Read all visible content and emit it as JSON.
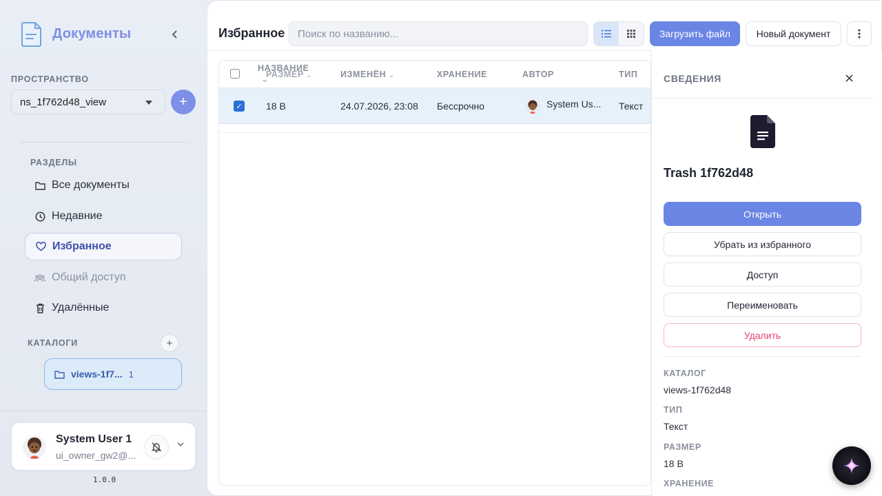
{
  "sidebar": {
    "brand_title": "Документы",
    "space_caption": "ПРОСТРАНСТВО",
    "namespace_value": "ns_1f762d48_view",
    "sections_caption": "РАЗДЕЛЫ",
    "nav": {
      "all": "Все документы",
      "recent": "Недавние",
      "favorites": "Избранное",
      "shared": "Общий доступ",
      "deleted": "Удалённые"
    },
    "catalogs_caption": "КАТАЛОГИ",
    "catalog": {
      "name": "views-1f7...",
      "count": "1"
    },
    "user": {
      "name": "System User 1",
      "email": "ui_owner_gw2@..."
    },
    "version": "1.0.0"
  },
  "header": {
    "title": "Избранное",
    "search_placeholder": "Поиск по названию...",
    "upload_label": "Загрузить файл",
    "new_doc_label": "Новый документ"
  },
  "table": {
    "columns": {
      "name": "НАЗВАНИЕ",
      "size": "РАЗМЕР",
      "modified": "ИЗМЕНЁН",
      "storage": "ХРАНЕНИЕ",
      "author": "АВТОР",
      "type": "ТИП"
    },
    "row": {
      "size": "18 B",
      "modified": "24.07.2026, 23:08",
      "storage": "Бессрочно",
      "author": "System Us...",
      "type": "Текст"
    }
  },
  "details": {
    "caption": "СВЕДЕНИЯ",
    "file_name": "Trash 1f762d48",
    "open": "Открыть",
    "unfavorite": "Убрать из избранного",
    "access": "Доступ",
    "rename": "Переименовать",
    "delete": "Удалить",
    "meta": {
      "catalog_k": "КАТАЛОГ",
      "catalog_v": "views-1f762d48",
      "type_k": "ТИП",
      "type_v": "Текст",
      "size_k": "РАЗМЕР",
      "size_v": "18 B",
      "storage_k": "ХРАНЕНИЕ"
    }
  },
  "colors": {
    "accent": "#6b85e5",
    "brand": "#7d8fe3",
    "danger": "#e2456d",
    "selected_row": "#e6f1fc"
  }
}
